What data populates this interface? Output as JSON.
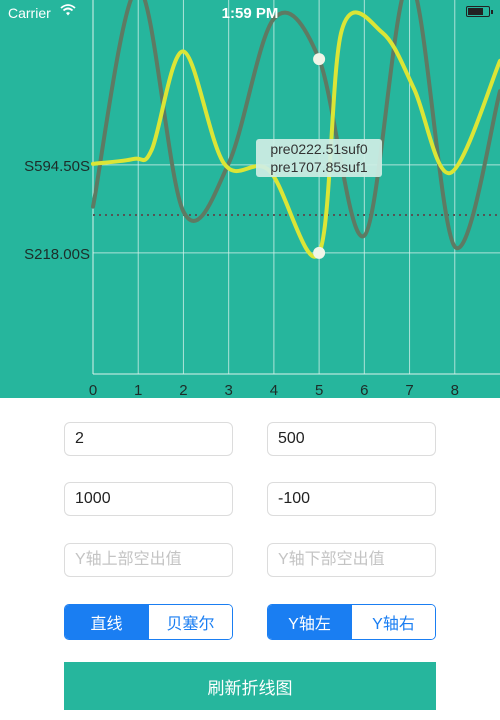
{
  "status_bar": {
    "carrier": "Carrier",
    "time": "1:59 PM"
  },
  "colors": {
    "background": "#26b69d",
    "series_1": "#dbe536",
    "series_2": "#5e7a63",
    "grid": "#d9f2ec",
    "limit_line": "#555555",
    "accent": "#1a7ef2",
    "button": "#26b69d"
  },
  "chart_data": {
    "type": "line",
    "x": [
      0,
      1,
      2,
      3,
      4,
      5,
      6,
      7,
      8
    ],
    "xlim": [
      0,
      9
    ],
    "ylim": [
      -300,
      1300
    ],
    "y_ticks": [
      {
        "value": 594.5,
        "label": "S594.50S"
      },
      {
        "value": 218.0,
        "label": "S218.00S"
      }
    ],
    "x_ticks": [
      "0",
      "1",
      "2",
      "3",
      "4",
      "5",
      "6",
      "7",
      "8"
    ],
    "grid": true,
    "limit_line": 380,
    "series": [
      {
        "curve": "smooth",
        "x": [
          0,
          0.9,
          1.3,
          2.0,
          2.9,
          3.9,
          5.0,
          5.5,
          6.4,
          7.1,
          7.9,
          9.0
        ],
        "values": [
          599,
          620,
          660,
          1080,
          600,
          570,
          218,
          1170,
          1160,
          920,
          560,
          1040
        ]
      },
      {
        "curve": "smooth",
        "x": [
          0,
          1,
          2,
          3,
          4,
          5,
          6,
          7,
          8,
          9
        ],
        "values": [
          416,
          1350,
          395,
          601,
          1220,
          1047,
          292,
          1380,
          245,
          910
        ]
      }
    ],
    "highlight": {
      "x": 5,
      "points": [
        1047,
        218
      ],
      "tooltip": [
        "pre0222.51suf0",
        "pre1707.85suf1"
      ]
    }
  },
  "inputs": {
    "field_1": {
      "value": "2",
      "placeholder": ""
    },
    "field_2": {
      "value": "500",
      "placeholder": ""
    },
    "field_3": {
      "value": "1000",
      "placeholder": ""
    },
    "field_4": {
      "value": "-100",
      "placeholder": ""
    },
    "field_5": {
      "value": "",
      "placeholder": "Y轴上部空出值"
    },
    "field_6": {
      "value": "",
      "placeholder": "Y轴下部空出值"
    }
  },
  "segments": {
    "line_type": {
      "options": [
        "直线",
        "贝塞尔"
      ],
      "selected": "直线"
    },
    "axis_side": {
      "options": [
        "Y轴左",
        "Y轴右"
      ],
      "selected": "Y轴左"
    }
  },
  "refresh_button": {
    "label": "刷新折线图"
  }
}
